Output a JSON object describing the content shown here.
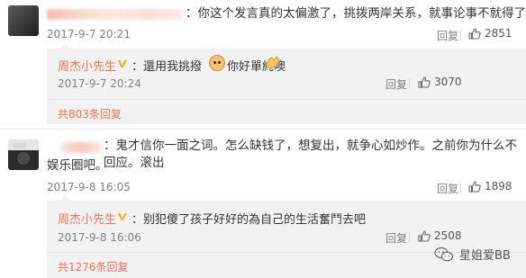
{
  "comments": [
    {
      "text": "：你这个发言真的太偏激了，挑拨两岸关系，就事论事不就得了",
      "time": "2017-9-7 20:21",
      "reply_label": "回复",
      "likes": "2851",
      "sub_reply": {
        "author": "周杰小先生",
        "text": "：還用我挑撥",
        "text_tail": "你好單純噢",
        "time": "2017-9-7 20:24",
        "reply_label": "回复",
        "likes": "3070"
      },
      "more_replies": "共803条回复"
    },
    {
      "text_line1": "：鬼才信你一面之词。怎么缺钱了，想复出，就争心如炒作。之前你为什么不回应。滚出",
      "text_line2": "娱乐圈吧。",
      "time": "2017-9-8 16:05",
      "reply_label": "回复",
      "likes": "1898",
      "sub_reply": {
        "author": "周杰小先生",
        "text": "：别犯傻了孩子好好的為自己的生活奮鬥去吧",
        "time": "2017-9-8 16:06",
        "reply_label": "回复",
        "likes": "2508"
      },
      "more_replies": "共1276条回复"
    }
  ],
  "watermark": "星姐爱BB",
  "colors": {
    "accent": "#eb7350",
    "verified": "#f5a623",
    "muted": "#808080"
  },
  "icons": [
    "thumbs-up-icon",
    "verified-badge-icon",
    "cat-emoji-icon",
    "clap-emoji-icon",
    "wechat-logo-icon"
  ]
}
